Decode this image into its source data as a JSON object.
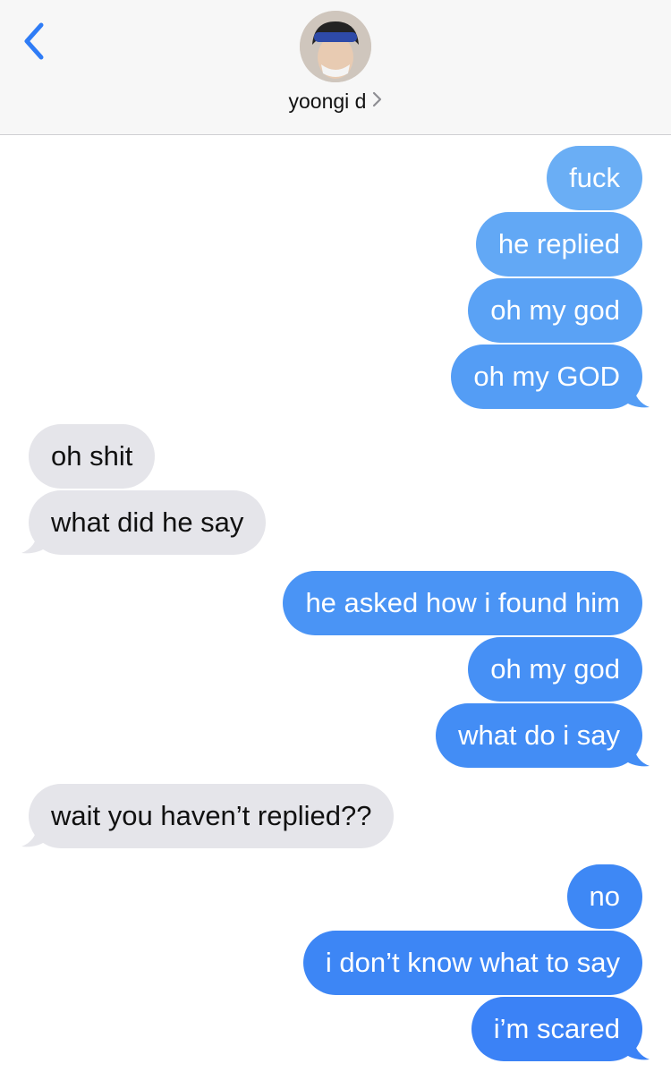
{
  "header": {
    "contact_name": "yoongi d",
    "back_icon": "chevron-left-icon",
    "contact_chevron_icon": "chevron-right-icon",
    "accent_color": "#2f7cf6"
  },
  "colors": {
    "sent_light": "#6aaef5",
    "sent_dark": "#3b82f6",
    "received": "#e5e5ea"
  },
  "messages": [
    {
      "from": "me",
      "text": "fuck"
    },
    {
      "from": "me",
      "text": "he replied"
    },
    {
      "from": "me",
      "text": "oh my god"
    },
    {
      "from": "me",
      "text": "oh my GOD"
    },
    {
      "from": "them",
      "text": "oh shit"
    },
    {
      "from": "them",
      "text": "what did he say"
    },
    {
      "from": "me",
      "text": "he asked how i found him"
    },
    {
      "from": "me",
      "text": "oh my god"
    },
    {
      "from": "me",
      "text": "what do i say"
    },
    {
      "from": "them",
      "text": "wait you haven’t replied??"
    },
    {
      "from": "me",
      "text": "no"
    },
    {
      "from": "me",
      "text": "i don’t know what to say"
    },
    {
      "from": "me",
      "text": "i’m scared"
    }
  ]
}
